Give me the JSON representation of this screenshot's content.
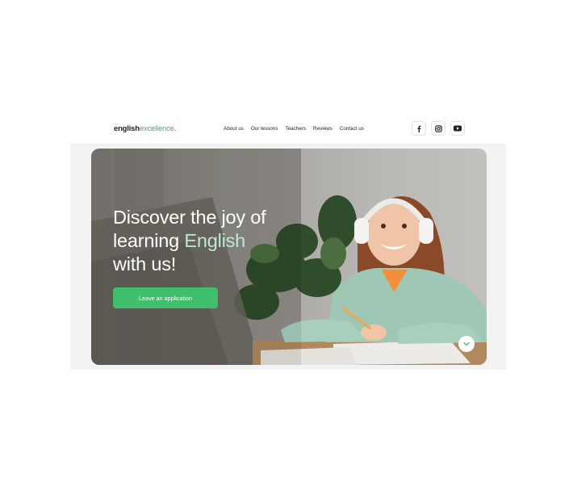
{
  "logo": {
    "part1": "english",
    "part2": "excellence",
    "dot": "."
  },
  "nav": {
    "items": [
      {
        "label": "About us"
      },
      {
        "label": "Our lessons"
      },
      {
        "label": "Teachers"
      },
      {
        "label": "Reviews"
      },
      {
        "label": "Contact us"
      }
    ]
  },
  "social": [
    "facebook-icon",
    "instagram-icon",
    "youtube-icon"
  ],
  "hero": {
    "line1": "Discover the joy of",
    "line2_prefix": "learning ",
    "line2_highlight": "English",
    "line3": "with us!",
    "cta_label": "Leave an application"
  },
  "colors": {
    "accent": "#3fbf6c",
    "highlight": "#bfe9cd",
    "text_dark": "#1f1f1f"
  }
}
